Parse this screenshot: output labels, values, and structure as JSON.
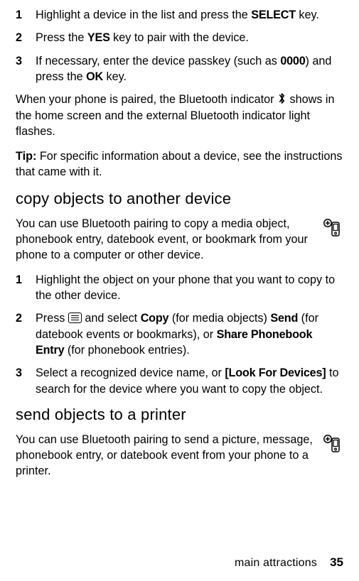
{
  "stepsA": [
    {
      "num": "1",
      "pre": "Highlight a device in the list and press the ",
      "key": "SELECT",
      "post": " key."
    },
    {
      "num": "2",
      "pre": "Press the ",
      "key": "YES",
      "post": " key to pair with the device."
    }
  ],
  "stepA3": {
    "num": "3",
    "p1": "If necessary, enter the device passkey (such as ",
    "code": "0000",
    "p2": ") and press the ",
    "key": "OK",
    "p3": " key."
  },
  "paired_text": "When your phone is paired, the Bluetooth indicator ",
  "paired_text2": " shows in the home screen and the external Bluetooth indicator light flashes.",
  "tip_label": "Tip:",
  "tip_text": " For specific information about a device, see the instructions that came with it.",
  "heading_copy": "copy objects to another device",
  "copy_intro": "You can use Bluetooth pairing to copy a media object, phonebook entry, datebook event, or bookmark from your phone to a computer or other device.",
  "stepB1": {
    "num": "1",
    "text": "Highlight the object on your phone that you want to copy to the other device."
  },
  "stepB2": {
    "num": "2",
    "p1": "Press ",
    "p2": " and select ",
    "k1": "Copy",
    "p3": " (for media objects) ",
    "k2": "Send",
    "p4": " (for datebook events or bookmarks), or ",
    "k3": "Share Phonebook Entry",
    "p5": " (for phonebook entries)."
  },
  "stepB3": {
    "num": "3",
    "p1": "Select a recognized device name, or ",
    "k1": "[Look For Devices]",
    "p2": " to search for the device where you want to copy the object."
  },
  "heading_print": "send objects to a printer",
  "print_intro": "You can use Bluetooth pairing to send a picture, message, phonebook entry, or datebook event from your phone to a printer.",
  "footer_section": "main attractions",
  "footer_page": "35"
}
